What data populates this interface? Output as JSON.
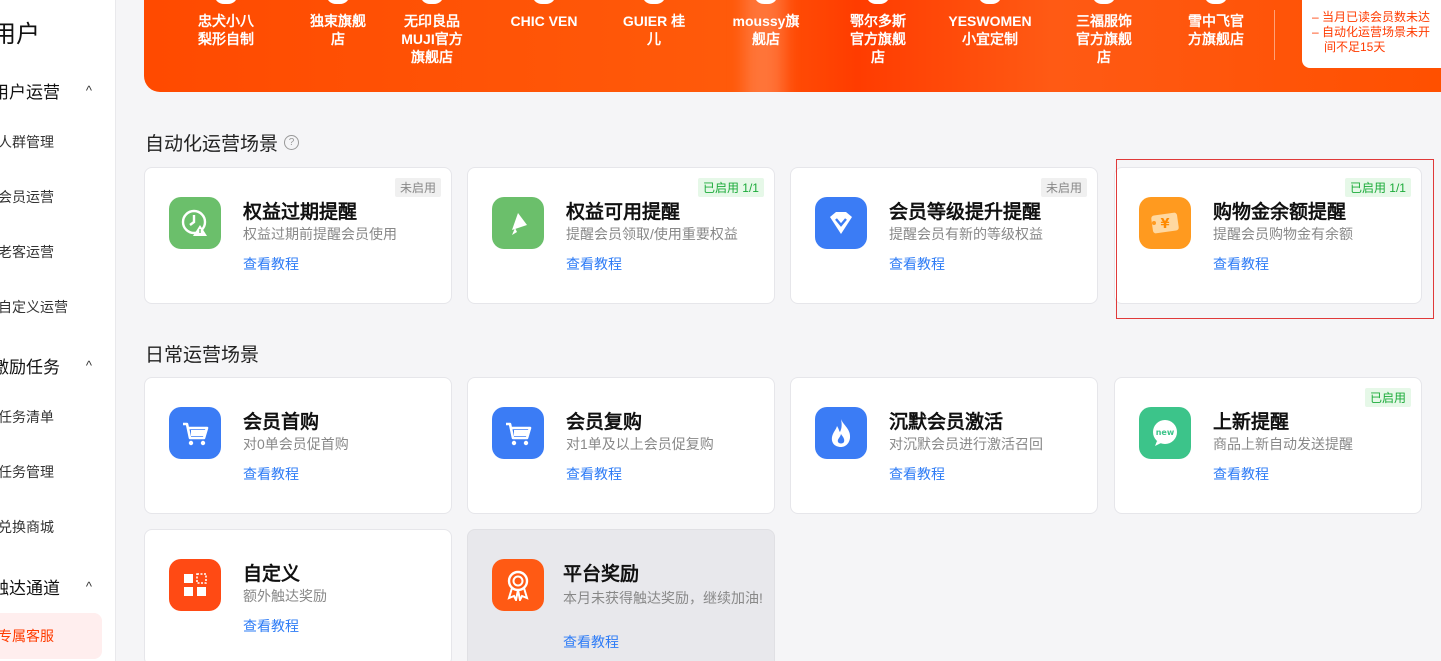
{
  "sidebar": {
    "title": "用户",
    "groups": [
      {
        "label": "用户运营",
        "items": [
          "人群管理",
          "会员运营",
          "老客运营",
          "自定义运营"
        ]
      },
      {
        "label": "激励任务",
        "items": [
          "任务清单",
          "任务管理",
          "兑换商城"
        ]
      },
      {
        "label": "触达通道",
        "items": [
          "专属客服"
        ]
      }
    ]
  },
  "banner": {
    "shops": [
      "忠犬小八\n梨形自制",
      "独束旗舰\n店",
      "无印良品\nMUJI官方\n旗舰店",
      "CHIC VEN",
      "GUIER 桂\n儿",
      "moussy旗\n舰店",
      "鄂尔多斯\n官方旗舰\n店",
      "YESWOMEN\n小宜定制",
      "三福服饰\n官方旗舰\n店",
      "雪中飞官\n方旗舰店"
    ],
    "notices": [
      "– 当月已读会员数未达",
      "– 自动化运营场景未开",
      "间不足15天"
    ]
  },
  "auto_section": {
    "title": "自动化运营场景"
  },
  "daily_section": {
    "title": "日常运营场景"
  },
  "link_label": "查看教程",
  "auto_cards": [
    {
      "title": "权益过期提醒",
      "desc": "权益过期前提醒会员使用",
      "badge": "未启用",
      "icon": "clock-alert-icon",
      "color": "#6bbf6b"
    },
    {
      "title": "权益可用提醒",
      "desc": "提醒会员领取/使用重要权益",
      "badge": "已启用 1/1",
      "icon": "megaphone-icon",
      "color": "#6bbf6b"
    },
    {
      "title": "会员等级提升提醒",
      "desc": "提醒会员有新的等级权益",
      "badge": "未启用",
      "icon": "diamond-icon",
      "color": "#3b7cf5"
    },
    {
      "title": "购物金余额提醒",
      "desc": "提醒会员购物金有余额",
      "badge": "已启用 1/1",
      "icon": "coupon-yen-icon",
      "color": "#ff9a1f"
    }
  ],
  "daily_cards": [
    {
      "title": "会员首购",
      "desc": "对0单会员促首购",
      "icon": "cart-icon",
      "color": "#3b7cf5"
    },
    {
      "title": "会员复购",
      "desc": "对1单及以上会员促复购",
      "icon": "cart-icon",
      "color": "#3b7cf5"
    },
    {
      "title": "沉默会员激活",
      "desc": "对沉默会员进行激活召回",
      "icon": "fire-icon",
      "color": "#3b7cf5"
    },
    {
      "title": "上新提醒",
      "desc": "商品上新自动发送提醒",
      "badge": "已启用",
      "icon": "new-chat-icon",
      "color": "#3cc48a"
    },
    {
      "title": "自定义",
      "desc": "额外触达奖励",
      "icon": "grid-icon",
      "color": "#ff4a14"
    },
    {
      "title": "平台奖励",
      "desc": "本月未获得触达奖励，继续加油!",
      "icon": "medal-icon",
      "color": "#ff5a14"
    }
  ]
}
